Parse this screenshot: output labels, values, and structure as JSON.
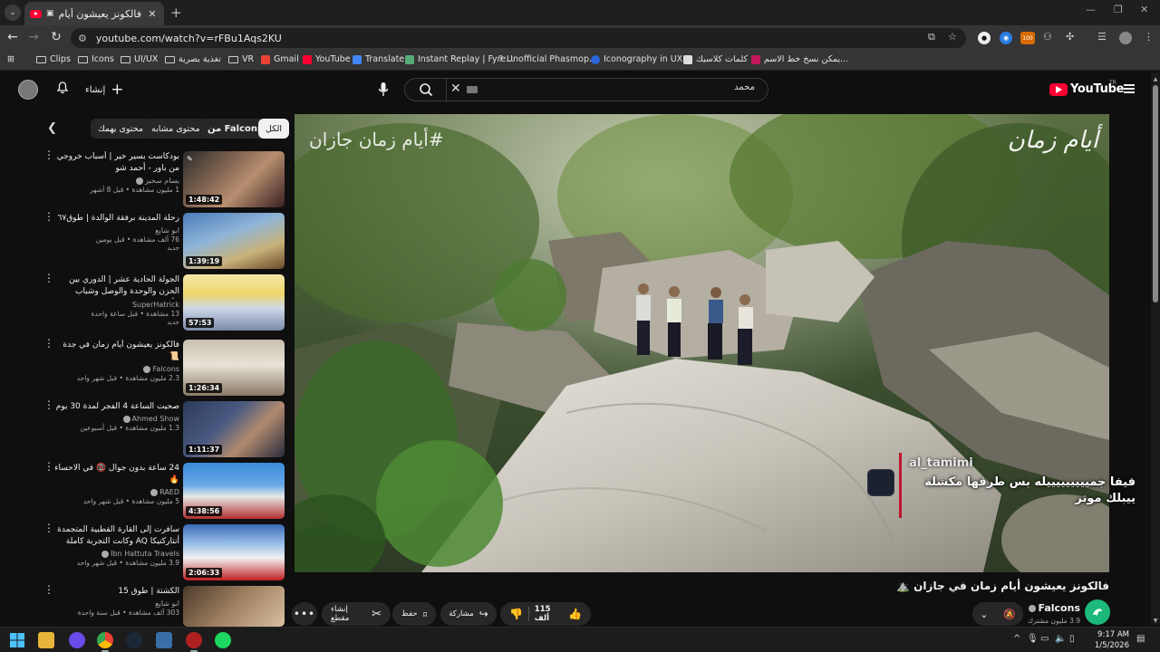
{
  "browser": {
    "tab_title": "فالكونز يعيشون أيام زمان في",
    "url": "youtube.com/watch?v=rFBu1Aqs2KU",
    "bookmarks": [
      {
        "label": "Clips",
        "type": "folder"
      },
      {
        "label": "Icons",
        "type": "folder"
      },
      {
        "label": "UI/UX",
        "type": "folder"
      },
      {
        "label": "تغذية بصرية",
        "type": "folder"
      },
      {
        "label": "VR",
        "type": "folder"
      },
      {
        "label": "Gmail",
        "type": "site"
      },
      {
        "label": "YouTube",
        "type": "site"
      },
      {
        "label": "Translate",
        "type": "site"
      },
      {
        "label": "Instant Replay | Fyre...",
        "type": "site"
      },
      {
        "label": "Unofficial Phasmop...",
        "type": "site"
      },
      {
        "label": "Iconography in UX...",
        "type": "site"
      },
      {
        "label": "كلمات كلاسيك",
        "type": "site"
      },
      {
        "label": "يمكن نسخ خط الاسم...",
        "type": "site"
      }
    ],
    "extension_badge": "100"
  },
  "header": {
    "create_label": "إنشاء",
    "search_value": "محمد",
    "logo_text": "YouTube",
    "logo_region": "TR"
  },
  "chips": [
    {
      "label": "الكل"
    },
    {
      "label": "من Falcons"
    },
    {
      "label": "محتوى مشابه"
    },
    {
      "label": "محتوى يهمك"
    }
  ],
  "related": [
    {
      "title": "بودكاست بسير خير | أسباب خروجي من باور - أحمد شو",
      "channel": "بسام سخير",
      "meta": "1 مليون مشاهدة • قبل 8 أشهر",
      "badge": "",
      "duration": "1:48:42",
      "verified": true
    },
    {
      "title": "رحلة المدينة برفقة الوالدة | طوق٦٧",
      "channel": "ابو شايع",
      "meta": "76 ألف مشاهدة • قبل يومين",
      "badge": "جديد",
      "duration": "1:39:19",
      "verified": false
    },
    {
      "title": "الجولة الحادية عشر | الدوري بين الحزن والوحدة والوصل وشباب الأهلي",
      "channel": "SuperHatrick",
      "meta": "13 مشاهدة • قبل ساعة واحدة",
      "badge": "جديد",
      "duration": "57:53",
      "verified": false
    },
    {
      "title": "فالكونز يعيشون أيام زمان في جدة 📜",
      "channel": "Falcons",
      "meta": "2.3 مليون مشاهدة • قبل شهر واحد",
      "badge": "",
      "duration": "1:26:34",
      "verified": true
    },
    {
      "title": "صحيت الساعة 4 الفجر لمدة 30 يوم",
      "channel": "Ahmed Show",
      "meta": "1.3 مليون مشاهدة • قبل أسبوعين",
      "badge": "",
      "duration": "1:11:37",
      "verified": true
    },
    {
      "title": "24 ساعة بدون جوال 📵 في الاحساء 🔥",
      "channel": "RAED",
      "meta": "5 مليون مشاهدة • قبل شهر واحد",
      "badge": "",
      "duration": "4:38:56",
      "verified": true
    },
    {
      "title": "سافرت إلى القارة القطبية المتجمدة أنتاركتيكا AQ وكانت التجربة كاملة",
      "channel": "Ibn Hattuta Travels",
      "meta": "3.9 مليون مشاهدة • قبل شهر واحد",
      "badge": "",
      "duration": "2:06:33",
      "verified": true
    },
    {
      "title": "الكشتة | طوق 15",
      "channel": "ابو شايع",
      "meta": "303 ألف مشاهدة • قبل سنة واحدة",
      "badge": "",
      "duration": "",
      "verified": false
    }
  ],
  "player": {
    "overlay_hashtag": "#أيام زمان جازان",
    "overlay_logo": "أيام زمان",
    "chat_user": "al_tamimi",
    "chat_text": "فيفا جميييييييييله بس طرقها مكشلة ييبلك موتر"
  },
  "video": {
    "title": "فالكونز يعيشون أيام زمان في جازان ⛰️",
    "channel": "Falcons",
    "subscribers": "3.9 مليون مشترك",
    "likes": "115 ألف",
    "share_label": "مشاركة",
    "save_label": "حفظ",
    "clip_label": "إنشاء مقطع"
  },
  "taskbar": {
    "time": "9:17 AM",
    "date": "1/5/2026"
  },
  "colors": {
    "yt_red": "#ff0033",
    "background": "#0f0f0f",
    "chip_bg": "#272727",
    "chat_accent": "#c0152b"
  }
}
